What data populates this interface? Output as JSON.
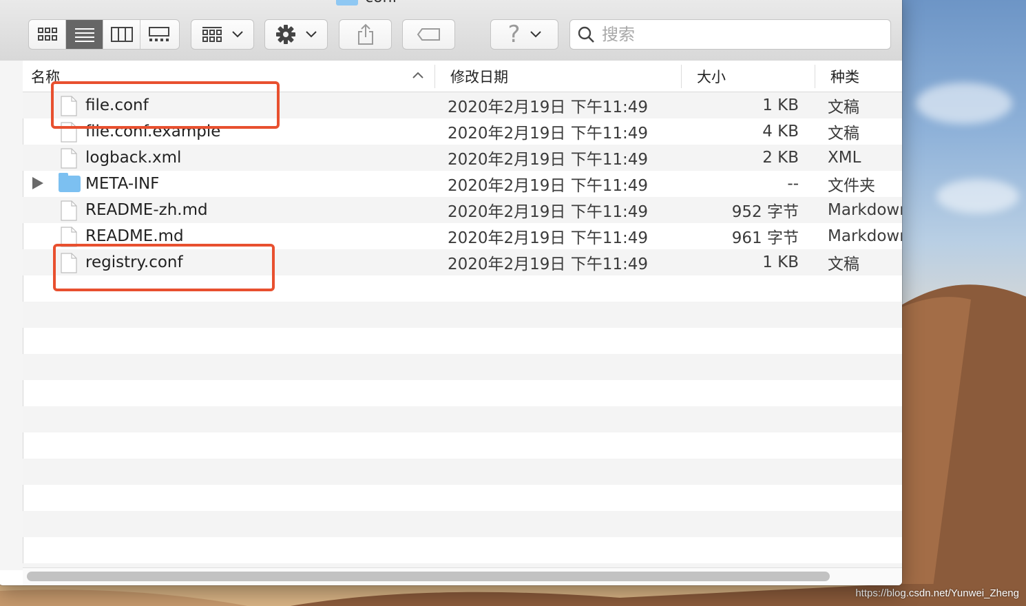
{
  "window": {
    "title": "conf"
  },
  "toolbar": {
    "view_buttons": [
      "icon-view",
      "list-view",
      "column-view",
      "gallery-view"
    ],
    "search_placeholder": "搜索"
  },
  "columns": [
    {
      "label": "名称"
    },
    {
      "label": "修改日期"
    },
    {
      "label": "大小"
    },
    {
      "label": "种类"
    }
  ],
  "files": [
    {
      "name": "file.conf",
      "date": "2020年2月19日 下午11:49",
      "size": "1 KB",
      "kind": "文稿"
    },
    {
      "name": "file.conf.example",
      "date": "2020年2月19日 下午11:49",
      "size": "4 KB",
      "kind": "文稿"
    },
    {
      "name": "logback.xml",
      "date": "2020年2月19日 下午11:49",
      "size": "2 KB",
      "kind": "XML"
    },
    {
      "name": "META-INF",
      "date": "2020年2月19日 下午11:49",
      "size": "--",
      "kind": "文件夹"
    },
    {
      "name": "README-zh.md",
      "date": "2020年2月19日 下午11:49",
      "size": "952 字节",
      "kind": "Markdown"
    },
    {
      "name": "README.md",
      "date": "2020年2月19日 下午11:49",
      "size": "961 字节",
      "kind": "Markdown"
    },
    {
      "name": "registry.conf",
      "date": "2020年2月19日 下午11:49",
      "size": "1 KB",
      "kind": "文稿"
    }
  ],
  "watermark": "https://blog.csdn.net/Yunwei_Zheng",
  "colors": {
    "highlight": "#e8502f",
    "folder": "#7cc0f1",
    "active_segment": "#666666"
  }
}
